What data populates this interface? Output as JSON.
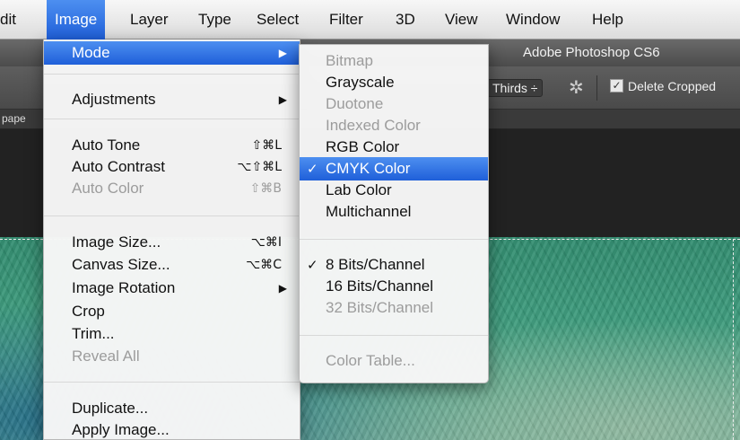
{
  "menubar": {
    "items": [
      "Edit",
      "Image",
      "Layer",
      "Type",
      "Select",
      "Filter",
      "3D",
      "View",
      "Window",
      "Help"
    ],
    "active_index": 1,
    "edit_visible": "dit"
  },
  "window": {
    "title": "Adobe Photoshop CS6"
  },
  "options_bar": {
    "overlay_label": "Thirds ÷",
    "delete_cropped_label": "Delete Cropped",
    "delete_cropped_checked": true,
    "gear_icon": "gear-icon"
  },
  "document_tab": {
    "label": "pape"
  },
  "image_menu": {
    "items": [
      {
        "label": "Mode",
        "submenu": true,
        "highlighted": true
      },
      {
        "label": "Adjustments",
        "submenu": true
      },
      {
        "label": "Auto Tone",
        "shortcut": "⇧⌘L"
      },
      {
        "label": "Auto Contrast",
        "shortcut": "⌥⇧⌘L"
      },
      {
        "label": "Auto Color",
        "shortcut": "⇧⌘B",
        "disabled": true
      },
      {
        "label": "Image Size...",
        "shortcut": "⌥⌘I"
      },
      {
        "label": "Canvas Size...",
        "shortcut": "⌥⌘C"
      },
      {
        "label": "Image Rotation",
        "submenu": true
      },
      {
        "label": "Crop"
      },
      {
        "label": "Trim..."
      },
      {
        "label": "Reveal All",
        "disabled": true
      },
      {
        "label": "Duplicate..."
      },
      {
        "label": "Apply Image..."
      }
    ]
  },
  "mode_submenu": {
    "items": [
      {
        "label": "Bitmap",
        "disabled": true
      },
      {
        "label": "Grayscale"
      },
      {
        "label": "Duotone",
        "disabled": true
      },
      {
        "label": "Indexed Color",
        "disabled": true
      },
      {
        "label": "RGB Color"
      },
      {
        "label": "CMYK Color",
        "checked": true,
        "highlighted": true
      },
      {
        "label": "Lab Color"
      },
      {
        "label": "Multichannel"
      },
      {
        "label": "8 Bits/Channel",
        "checked": true
      },
      {
        "label": "16 Bits/Channel"
      },
      {
        "label": "32 Bits/Channel",
        "disabled": true
      },
      {
        "label": "Color Table...",
        "disabled": true
      }
    ],
    "check_glyph": "✓"
  },
  "colors": {
    "highlight": "#2f73e6",
    "disabled_text": "#9c9c9c",
    "ps_chrome": "#4c4c4c"
  }
}
